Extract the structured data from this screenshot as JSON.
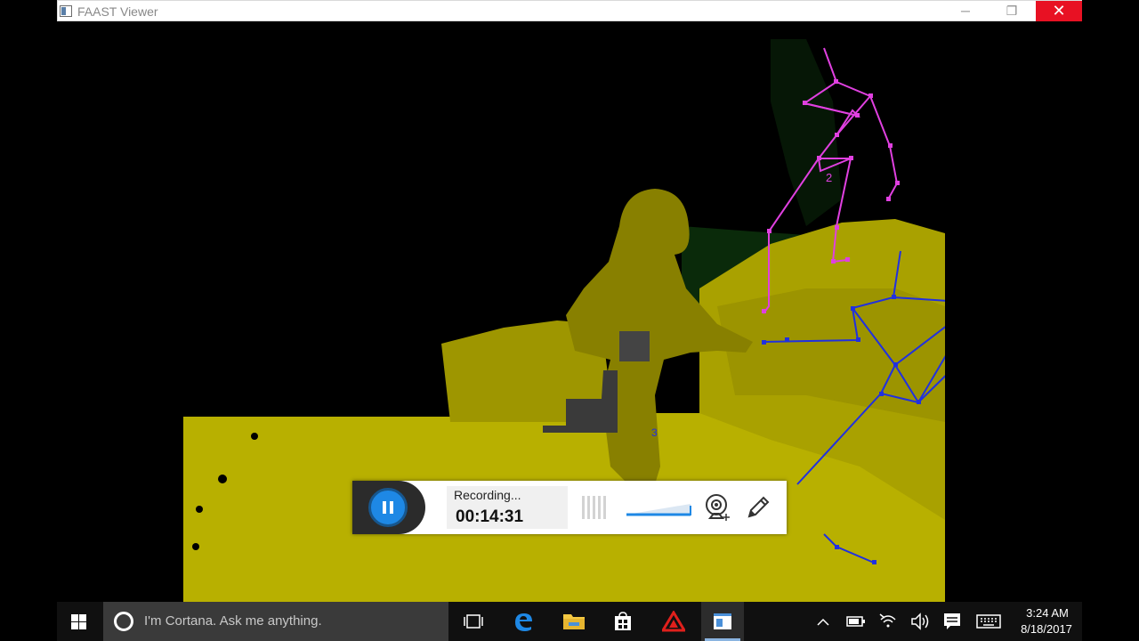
{
  "window": {
    "title": "FAAST Viewer",
    "minimize_label": "─",
    "maximize_label": "❐",
    "close_label": "✕"
  },
  "depth_view": {
    "skeletons": [
      {
        "id_label": "2",
        "color": "#e040e0"
      },
      {
        "id_label": "3",
        "color": "#2030e0"
      }
    ],
    "depth_color": "#bfb600"
  },
  "recorder": {
    "status": "Recording...",
    "elapsed": "00:14:31",
    "accent": "#1e88e5",
    "icons": [
      "pause-icon",
      "pause-bars-icon",
      "volume-slider",
      "webcam-icon",
      "pen-icon"
    ]
  },
  "taskbar": {
    "search_placeholder": "I'm Cortana. Ask me anything.",
    "apps": [
      "task-view-icon",
      "edge-icon",
      "file-explorer-icon",
      "store-icon",
      "app-red-triangle-icon",
      "faast-viewer-icon"
    ],
    "clock_time": "3:24 AM",
    "clock_date": "8/18/2017"
  }
}
